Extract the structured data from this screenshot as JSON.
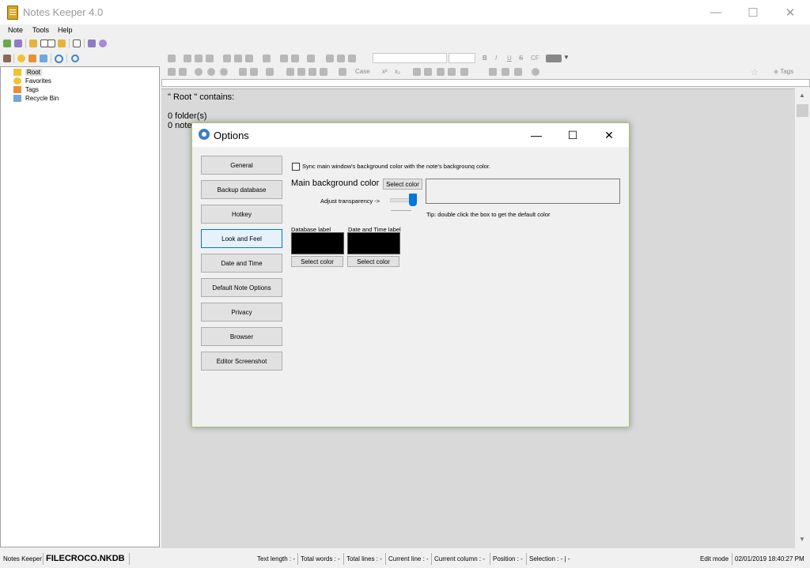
{
  "window": {
    "title": "Notes Keeper 4.0",
    "minimize": "—",
    "maximize": "☐",
    "close": "✕"
  },
  "menu": [
    "Note",
    "Tools",
    "Help"
  ],
  "tree": {
    "items": [
      "Root",
      "Favorites",
      "Tags",
      "Recycle Bin"
    ]
  },
  "toolbar": {
    "font_case_label": "Case",
    "cf_label": "CF",
    "bold": "B",
    "italic": "I",
    "underline": "U",
    "strike": "S",
    "tags_label": "Tags",
    "superscript": "x²",
    "subscript": "x₂"
  },
  "editor": {
    "lines": [
      "\" Root \" contains:",
      "",
      "0 folder(s)",
      "0 note"
    ]
  },
  "dialog": {
    "title": "Options",
    "nav": [
      "General",
      "Backup database",
      "Hotkey",
      "Look and Feel",
      "Date and Time",
      "Default Note Options",
      "Privacy",
      "Browser",
      "Editor Screenshot"
    ],
    "active_nav": "Look and Feel",
    "sync_checkbox_label": "Sync main window's background color with the note's backgrounq color.",
    "sync_checked": false,
    "main_bg_label": "Main background color",
    "select_color": "Select color",
    "transparency_label": "Adjust transparency ->",
    "transparency_value": 1.0,
    "tip": "Tip: double click the box to get the default color",
    "database_label": "Database label",
    "datetime_label": "Date and Time label",
    "database_color": "#000000",
    "datetime_color": "#000000"
  },
  "status": {
    "app": "Notes Keeper",
    "db_name": "FILECROCO.NKDB",
    "text_length": "Text length : -",
    "total_words": "Total words : -",
    "total_lines": "Total lines : -",
    "current_line": "Current line : -",
    "current_column": "Current column : -",
    "position": "Position : -",
    "selection": "Selection : - | -",
    "mode": "Edit mode",
    "datetime": "02/01/2019 18:40:27 PM"
  },
  "colors": {
    "dialog_border": "#a3c879",
    "active_nav_border": "#0078d7",
    "editor_bg": "#d9d9d9"
  }
}
